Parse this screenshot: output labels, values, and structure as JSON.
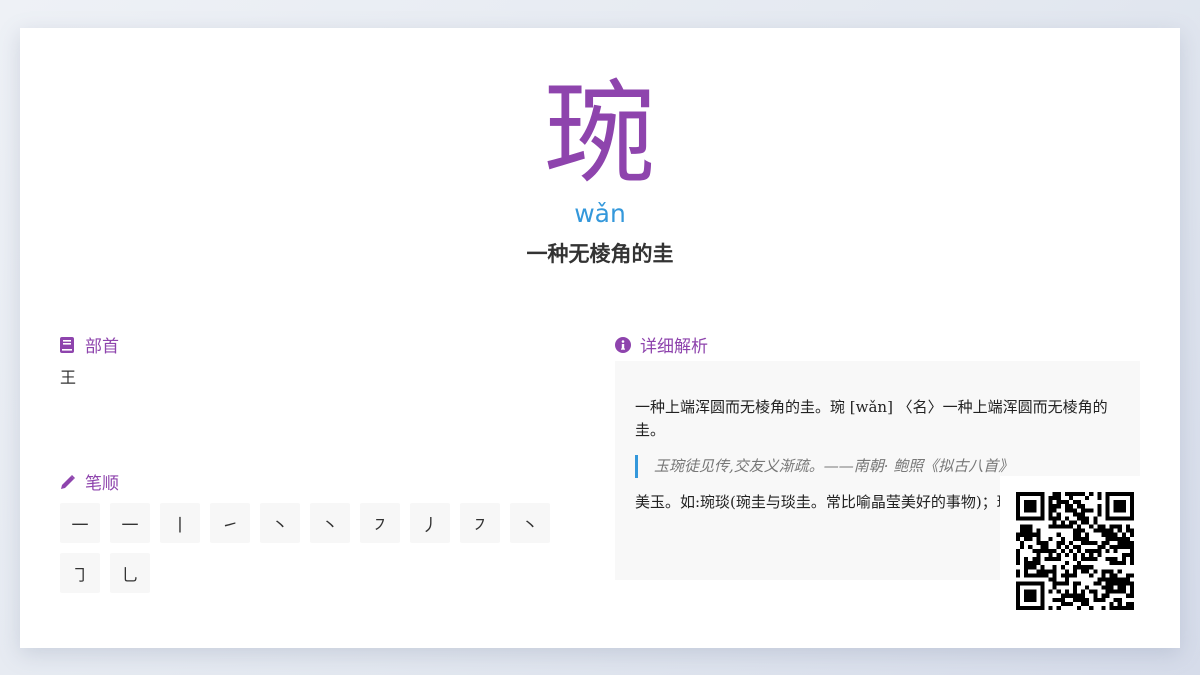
{
  "character": "琬",
  "pinyin": "wǎn",
  "brief_meaning": "一种无棱角的圭",
  "radical": {
    "title": "部首",
    "icon": "book-icon",
    "value": "王"
  },
  "strokes": {
    "title": "笔顺",
    "icon": "pencil-icon",
    "items": [
      "一",
      "一",
      "丨",
      "㇀",
      "丶",
      "丶",
      "㇇",
      "丿",
      "㇇",
      "丶",
      "㇆",
      "乚"
    ]
  },
  "detail": {
    "title": "详细解析",
    "icon": "info-circle-icon",
    "paragraph1": "一种上端浑圆而无棱角的圭。琬 [wǎn] 〈名〉一种上端浑圆而无棱角的圭。",
    "quote": "玉琬徒见传,交友义渐疏。——南朝· 鲍照《拟古八首》",
    "paragraph2": "美玉。如:琬琰(琬圭与琰圭。常比喻晶莹美好的事物)；琬象(美玉和象牙)"
  },
  "colors": {
    "accent_purple": "#8e44ad",
    "accent_blue": "#3498db"
  },
  "qr_icon": "qr-code-icon"
}
